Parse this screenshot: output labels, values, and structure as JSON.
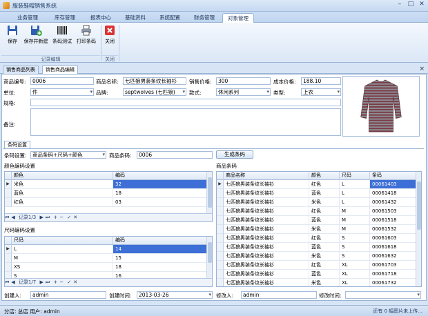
{
  "window": {
    "title": "服装鞋帽销售系统"
  },
  "menu_tabs": [
    "业务管理",
    "库存管理",
    "报表中心",
    "基础资料",
    "系统配置",
    "财务管理",
    "对象管理"
  ],
  "ribbon": {
    "buttons": [
      {
        "label": "保存",
        "icon": "save-icon"
      },
      {
        "label": "保存并新建",
        "icon": "save-new-icon"
      },
      {
        "label": "条码测试",
        "icon": "barcode-icon"
      },
      {
        "label": "打印条码",
        "icon": "printer-icon"
      },
      {
        "label": "关闭",
        "icon": "close-icon"
      }
    ],
    "groups": [
      "记录编辑",
      "关闭"
    ]
  },
  "doc_tabs": [
    "销售商品列表",
    "销售商品编辑"
  ],
  "form": {
    "code_label": "商品编号:",
    "code": "0006",
    "name_label": "商品名称:",
    "name": "七匹狼男装条纹长袖衫",
    "price_label": "销售价格:",
    "price": "300",
    "cost_label": "成本价格:",
    "cost": "188.10",
    "unit_label": "单位:",
    "unit": "件",
    "brand_label": "品牌:",
    "brand": "septwolves (七匹狼)",
    "style_label": "款式:",
    "style": "休闲系列",
    "type_label": "类型:",
    "type": "上衣",
    "spec_label": "规格:",
    "spec": "",
    "note_label": "备注:",
    "note": ""
  },
  "barcode_section": {
    "tab": "条码设置",
    "setting_label": "条码设置:",
    "setting": "商品条码+尺码+颜色",
    "goods_barcode_label": "商品条码:",
    "goods_barcode": "0006",
    "generate_button": "生成条码"
  },
  "color_grid": {
    "title": "颜色编码设置",
    "headers": [
      "颜色",
      "编码"
    ],
    "rows": [
      [
        "米色",
        "32"
      ],
      [
        "蓝色",
        "18"
      ],
      [
        "红色",
        "03"
      ]
    ],
    "nav": "记录1/3"
  },
  "size_grid": {
    "title": "尺码编码设置",
    "headers": [
      "尺码",
      "编码"
    ],
    "rows": [
      [
        "L",
        "14"
      ],
      [
        "M",
        "15"
      ],
      [
        "XS",
        "18"
      ],
      [
        "S",
        "16"
      ]
    ],
    "nav": "记录1/7"
  },
  "barcode_grid": {
    "title": "商品条码",
    "headers": [
      "商品名称",
      "颜色",
      "尺码",
      "条码"
    ],
    "rows": [
      [
        "七匹狼男装条纹长袖衫",
        "红色",
        "L",
        "00061403"
      ],
      [
        "七匹狼男装条纹长袖衫",
        "蓝色",
        "L",
        "00061418"
      ],
      [
        "七匹狼男装条纹长袖衫",
        "米色",
        "L",
        "00061432"
      ],
      [
        "七匹狼男装条纹长袖衫",
        "红色",
        "M",
        "00061503"
      ],
      [
        "七匹狼男装条纹长袖衫",
        "蓝色",
        "M",
        "00061518"
      ],
      [
        "七匹狼男装条纹长袖衫",
        "米色",
        "M",
        "00061532"
      ],
      [
        "七匹狼男装条纹长袖衫",
        "红色",
        "S",
        "00061603"
      ],
      [
        "七匹狼男装条纹长袖衫",
        "蓝色",
        "S",
        "00061618"
      ],
      [
        "七匹狼男装条纹长袖衫",
        "米色",
        "S",
        "00061632"
      ],
      [
        "七匹狼男装条纹长袖衫",
        "红色",
        "XL",
        "00061703"
      ],
      [
        "七匹狼男装条纹长袖衫",
        "蓝色",
        "XL",
        "00061718"
      ],
      [
        "七匹狼男装条纹长袖衫",
        "米色",
        "XL",
        "00061732"
      ]
    ]
  },
  "footer": {
    "creator_label": "创建人:",
    "creator": "admin",
    "created_label": "创建时间:",
    "created": "2013-03-26",
    "modifier_label": "修改人:",
    "modifier": "admin",
    "modified_label": "修改时间:",
    "modified": ""
  },
  "status": {
    "left": "分店: 总店  用户: admin",
    "right": "还有 0 幅图片未上传..."
  },
  "colors": {
    "accent": "#3d6fd6",
    "chrome": "#c5d9f1",
    "border": "#9ab4d6"
  }
}
